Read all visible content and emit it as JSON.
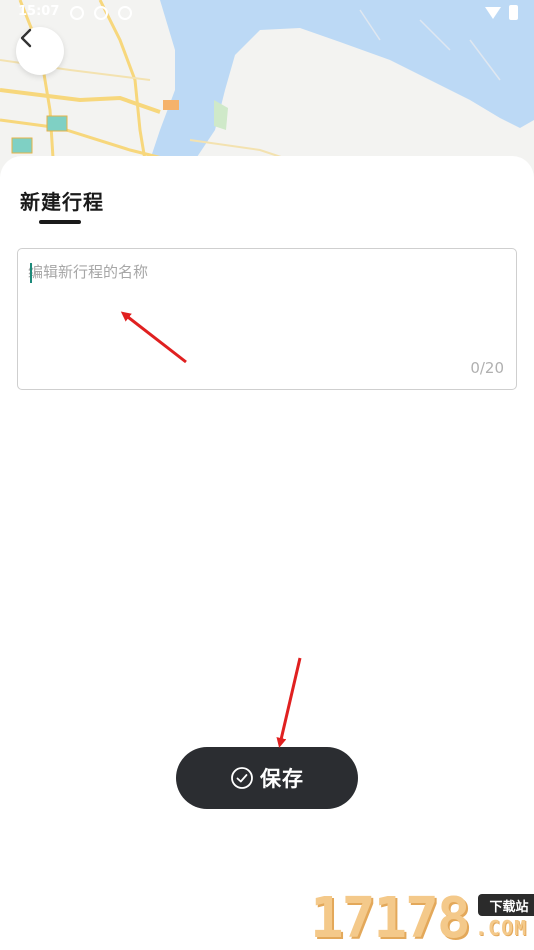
{
  "status_bar": {
    "time": "15:07"
  },
  "map": {
    "water_color": "#bcd9f5",
    "road_color": "#f7d77c",
    "land_color": "#f3f3f1"
  },
  "header": {
    "back_icon": "chevron-left-icon",
    "title": "新建行程"
  },
  "name_input": {
    "value": "",
    "placeholder": "编辑新行程的名称",
    "counter": "0/20"
  },
  "actions": {
    "save_icon": "check-circle-icon",
    "save_label": "保存"
  },
  "watermark": {
    "number": "17178",
    "badge": "下载站",
    "domain": ".COM"
  },
  "colors": {
    "button_bg": "#2b2d31",
    "arrow": "#e02020",
    "caret": "#1d8a7a"
  }
}
